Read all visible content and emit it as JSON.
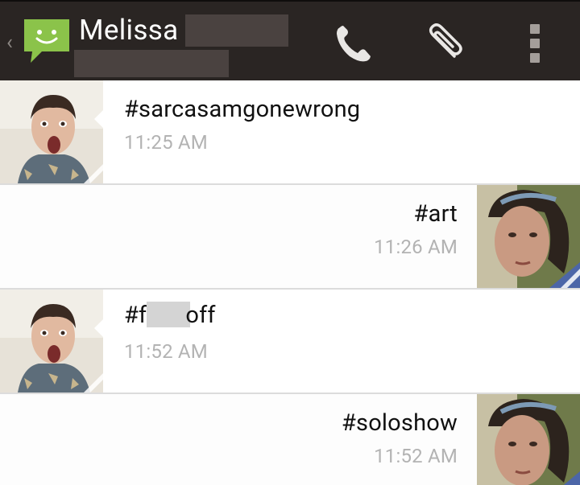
{
  "header": {
    "contact_name": "Melissa",
    "back_glyph": "‹",
    "app_icon": "messaging-bubble-icon",
    "actions": [
      {
        "name": "call",
        "icon": "phone-icon"
      },
      {
        "name": "attach",
        "icon": "paperclip-icon"
      },
      {
        "name": "overflow",
        "icon": "overflow-menu-icon"
      }
    ],
    "colors": {
      "bar": "#2a2523",
      "app_icon_green": "#8bc34a",
      "icon_gray": "#a49e9a"
    }
  },
  "messages": [
    {
      "direction": "incoming",
      "text": "#sarcasamgonewrong",
      "time": "11:25 AM",
      "avatar": "contact-avatar-surprised"
    },
    {
      "direction": "outgoing",
      "text": "#art",
      "time": "11:26 AM",
      "avatar": "self-avatar"
    },
    {
      "direction": "incoming",
      "text_prefix": "#f",
      "text_suffix": "off",
      "redacted": true,
      "time": "11:52 AM",
      "avatar": "contact-avatar-surprised"
    },
    {
      "direction": "outgoing",
      "text": "#soloshow",
      "time": "11:52 AM",
      "avatar": "self-avatar"
    }
  ]
}
